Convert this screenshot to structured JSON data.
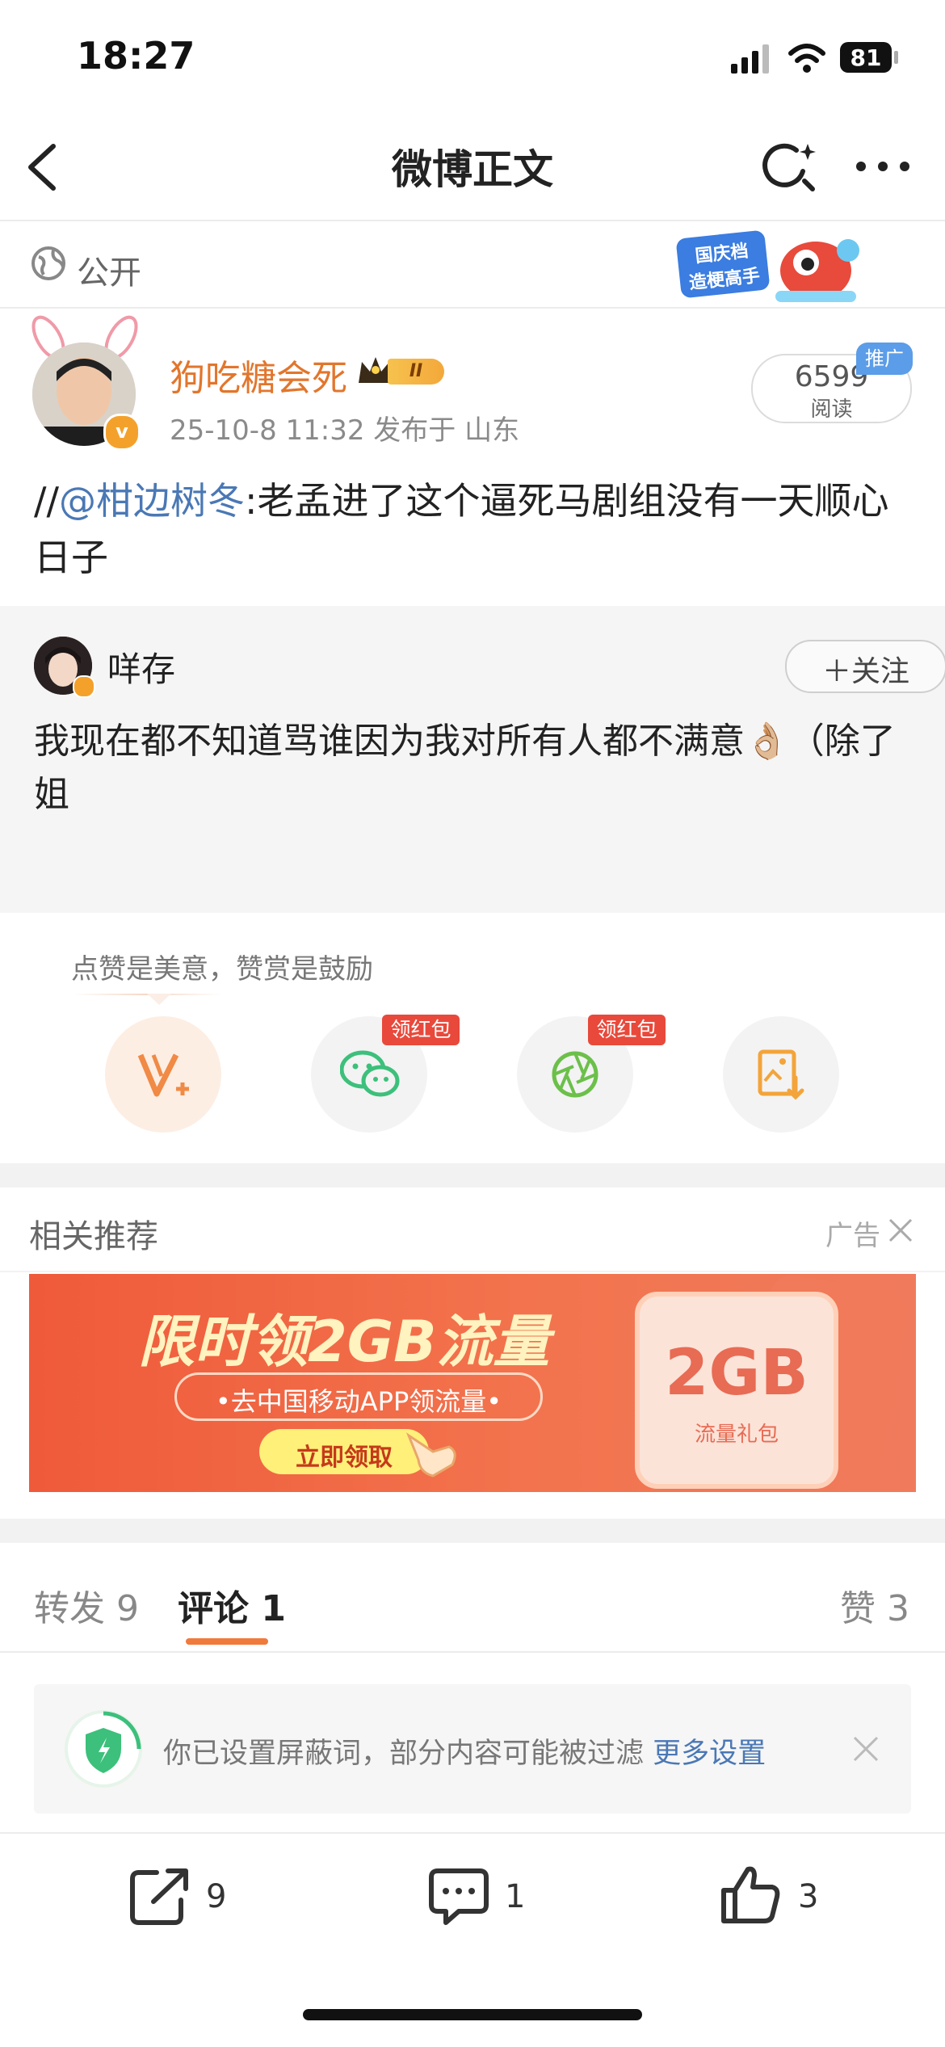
{
  "status_bar": {
    "time": "18:27",
    "battery": "81"
  },
  "nav": {
    "title": "微博正文"
  },
  "visibility": {
    "label": "公开",
    "banner_lines": [
      "国庆档",
      "造梗高手"
    ]
  },
  "post": {
    "username": "狗吃糖会死",
    "vip_level": "II",
    "meta": "25-10-8 11:32  发布于 山东",
    "read_count": "6599",
    "read_label": "阅读",
    "promo_badge": "推广",
    "text_prefix": "//",
    "mention": "@柑边树冬",
    "text_body": ":老孟进了这个逼死马剧组没有一天顺心日子"
  },
  "repost": {
    "author": "咩存",
    "follow_label": "关注",
    "text": "我现在都不知道骂谁因为我对所有人都不满意👌🏼（除了姐"
  },
  "reward": {
    "tip": "点赞是美意，赞赏是鼓励",
    "tags": [
      "领红包",
      "领红包"
    ]
  },
  "recommend": {
    "title": "相关推荐",
    "ad_label": "广告",
    "ad": {
      "headline": "限时领2GB流量",
      "sub": "•去中国移动APP领流量•",
      "cta": "立即领取",
      "card_big": "2GB",
      "card_small": "流量礼包"
    }
  },
  "tabs": {
    "repost_label": "转发",
    "repost_count": "9",
    "comment_label": "评论",
    "comment_count": "1",
    "like_label": "赞",
    "like_count": "3"
  },
  "notice": {
    "text": "你已设置屏蔽词，部分内容可能被过滤 ",
    "link": "更多设置"
  },
  "bottom_bar": {
    "repost": "9",
    "comment": "1",
    "like": "3"
  },
  "colors": {
    "accent": "#f07a3c",
    "username": "#e2762c",
    "link": "#4a78b5",
    "red_tag": "#e8493b"
  }
}
